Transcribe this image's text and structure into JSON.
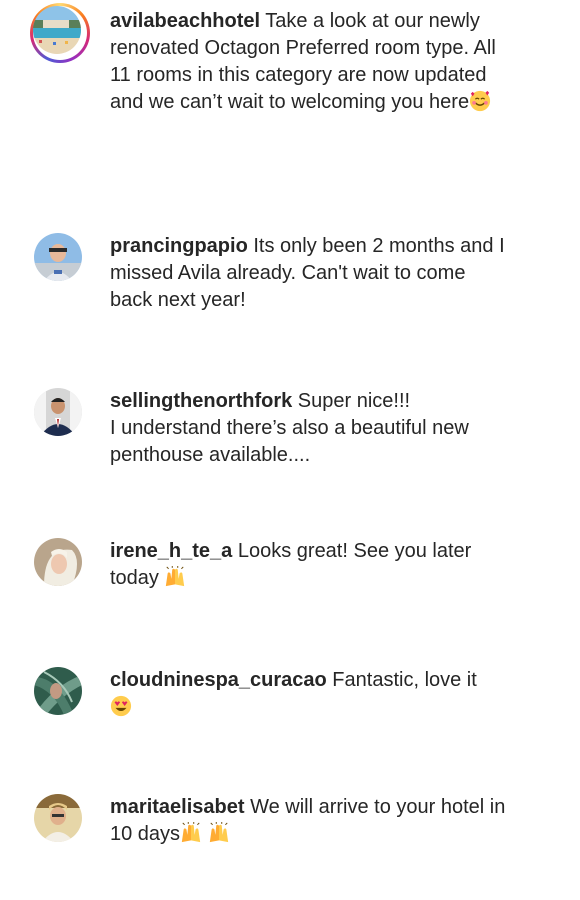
{
  "comments": [
    {
      "username": "avilabeachhotel",
      "text": " Take a look at our newly renovated Octagon Preferred room type. All 11 rooms in this category are now updated and we can’t wait to welcoming you here",
      "emoji": [
        "smiling-face-with-hearts-icon"
      ]
    },
    {
      "username": "prancingpapio",
      "text": " Its only been 2 months and I missed Avila already. Can't wait to come back next year!",
      "emoji": []
    },
    {
      "username": "sellingthenorthfork",
      "text": " Super nice!!!",
      "text2": "I understand there’s also a beautiful new penthouse available....",
      "emoji": []
    },
    {
      "username": "irene_h_te_a",
      "text": " Looks great! See you later today ",
      "emoji": [
        "raising-hands-icon"
      ]
    },
    {
      "username": "cloudninespa_curacao",
      "text": " Fantastic, love it",
      "emoji": [
        "heart-eyes-icon"
      ]
    },
    {
      "username": "maritaelisabet",
      "text": " We will arrive to your hotel in 10 days",
      "emoji": [
        "raising-hands-icon",
        "raising-hands-icon"
      ]
    }
  ]
}
